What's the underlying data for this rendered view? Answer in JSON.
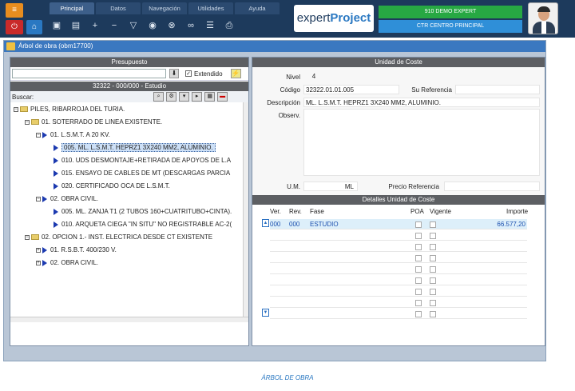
{
  "topbar": {
    "tabs": [
      "Principal",
      "Datos",
      "Navegación",
      "Utilidades",
      "Ayuda"
    ],
    "brand_word1": "expert",
    "brand_word2": "Project",
    "company": "910 DEMO EXPERT",
    "center": "CTR CENTRO PRINCIPAL",
    "tools": [
      "save-icon",
      "save-as-icon",
      "add-icon",
      "remove-icon",
      "filter-icon",
      "check-icon",
      "cancel-icon",
      "binoculars-icon",
      "list-icon",
      "print-icon"
    ]
  },
  "window": {
    "title": "Árbol de obra (obm17700)"
  },
  "left": {
    "budget_header": "Presupuesto",
    "extendido_label": "Extendido",
    "tree_header": "32322 - 000/000 - Estudio",
    "search_label": "Buscar:",
    "tree": [
      {
        "text": "PILES, RIBARROJA DEL TURIA.",
        "kind": "root"
      },
      {
        "text": "01. SOTERRADO DE LINEA EXISTENTE.",
        "kind": "group"
      },
      {
        "text": "01. L.S.M.T. A 20 KV.",
        "kind": "sub"
      },
      {
        "text": "005. ML. L.S.M.T. HEPRZ1 3X240 MM2, ALUMINIO.",
        "kind": "leaf",
        "selected": true
      },
      {
        "text": "010. UDS DESMONTAJE+RETIRADA DE APOYOS DE L.A",
        "kind": "leaf"
      },
      {
        "text": "015. ENSAYO DE CABLES DE MT (DESCARGAS PARCIA",
        "kind": "leaf"
      },
      {
        "text": "020. CERTIFICADO OCA DE L.S.M.T.",
        "kind": "leaf"
      },
      {
        "text": "02. OBRA CIVIL.",
        "kind": "sub"
      },
      {
        "text": "005. ML. ZANJA T1 (2 TUBOS 160+CUATRITUBO+CINTA).",
        "kind": "leaf"
      },
      {
        "text": "010. ARQUETA CIEGA \"IN SITU\" NO REGISTRABLE AC-2(",
        "kind": "leaf"
      },
      {
        "text": "02. OPCION 1.- INST. ELECTRICA DESDE CT EXISTENTE",
        "kind": "group"
      },
      {
        "text": "01. R.S.B.T. 400/230 V.",
        "kind": "sub"
      },
      {
        "text": "02. OBRA CIVIL.",
        "kind": "sub"
      }
    ]
  },
  "right": {
    "header": "Unidad de Coste",
    "nivel_label": "Nivel",
    "nivel_value": "4",
    "codigo_label": "Código",
    "codigo_value": "32322.01.01.005",
    "su_ref_label": "Su Referencia",
    "descripcion_label": "Descripción",
    "descripcion_value": "ML. L.S.M.T. HEPRZ1 3X240 MM2, ALUMINIO.",
    "observ_label": "Observ.",
    "um_label": "U.M.",
    "um_value": "ML",
    "precio_label": "Precio Referencia",
    "detalles_header": "Detalles Unidad de Coste",
    "columns": [
      "Ver.",
      "Rev.",
      "Fase",
      "POA",
      "Vigente",
      "Importe"
    ],
    "row": {
      "ver": "000",
      "rev": "000",
      "fase": "ESTUDIO",
      "importe": "66.577,20"
    }
  },
  "caption": "ÁRBOL DE OBRA"
}
